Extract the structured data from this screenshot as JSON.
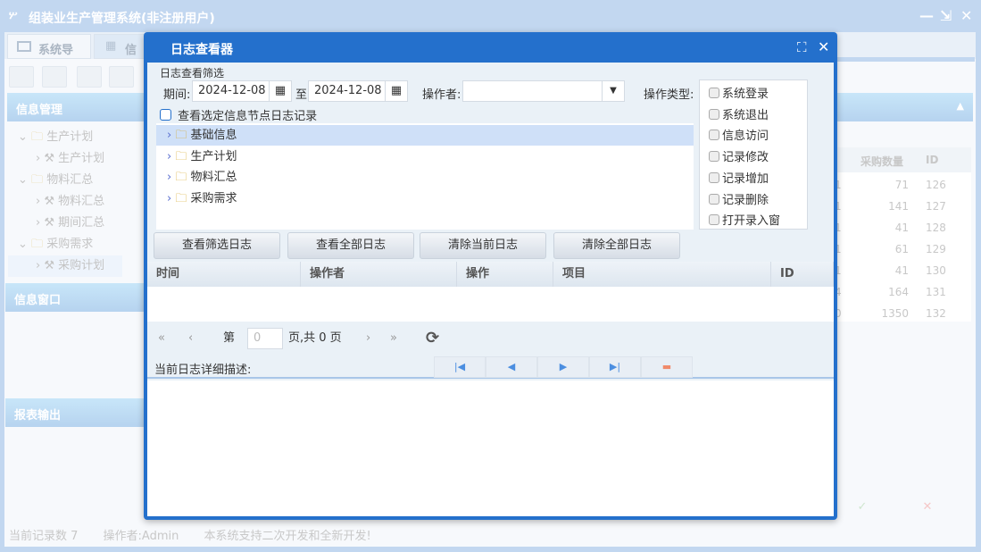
{
  "app": {
    "title": "组装业生产管理系统(非注册用户)",
    "minimize": "—",
    "restore": "⇲",
    "close": "✕"
  },
  "tabs": [
    {
      "label": "系统导航"
    },
    {
      "label": "信息"
    }
  ],
  "left_panel": {
    "header1": "信息管理",
    "tree": [
      {
        "label": "生产计划",
        "level": 0
      },
      {
        "label": "生产计划",
        "level": 1
      },
      {
        "label": "物料汇总",
        "level": 0
      },
      {
        "label": "物料汇总",
        "level": 1
      },
      {
        "label": "期间汇总",
        "level": 1
      },
      {
        "label": "采购需求",
        "level": 0
      },
      {
        "label": "采购计划",
        "level": 1
      }
    ],
    "header2": "信息窗口",
    "header3": "报表输出"
  },
  "bg_table": {
    "headers": [
      "采购数量",
      "ID"
    ],
    "partial": [
      "1",
      "1",
      "1",
      "1",
      "1",
      "4",
      "0"
    ],
    "qty": [
      "71",
      "141",
      "41",
      "61",
      "41",
      "164",
      "1350"
    ],
    "ids": [
      "126",
      "127",
      "128",
      "129",
      "130",
      "131",
      "132"
    ],
    "ok": "✓",
    "cancel": "✕"
  },
  "status": {
    "records": "当前记录数 7",
    "operator": "操作者:Admin",
    "note": "本系统支持二次开发和全新开发!"
  },
  "dialog": {
    "title": "日志查看器",
    "maximize": "⛶",
    "close": "✕",
    "filter_title": "日志查看筛选",
    "period_label": "期间:",
    "from": "2024-12-08",
    "to_label": "至",
    "to": "2024-12-08",
    "operator_label": "操作者:",
    "operator_value": "",
    "optype_label": "操作类型:",
    "optypes": [
      "系统登录",
      "系统退出",
      "信息访问",
      "记录修改",
      "记录增加",
      "记录删除",
      "打开录入窗"
    ],
    "node_check": "查看选定信息节点日志记录",
    "tree": [
      "基础信息",
      "生产计划",
      "物料汇总",
      "采购需求"
    ],
    "buttons": [
      "查看筛选日志",
      "查看全部日志",
      "清除当前日志",
      "清除全部日志"
    ],
    "columns": [
      "时间",
      "操作者",
      "操作",
      "项目",
      "ID"
    ],
    "pager": {
      "page_prefix": "第",
      "page": "0",
      "page_suffix": "页,共 0 页"
    },
    "detail_label": "当前日志详细描述:"
  },
  "colors": {
    "accent": "#2470cc",
    "selected": "#cfe0f8"
  }
}
